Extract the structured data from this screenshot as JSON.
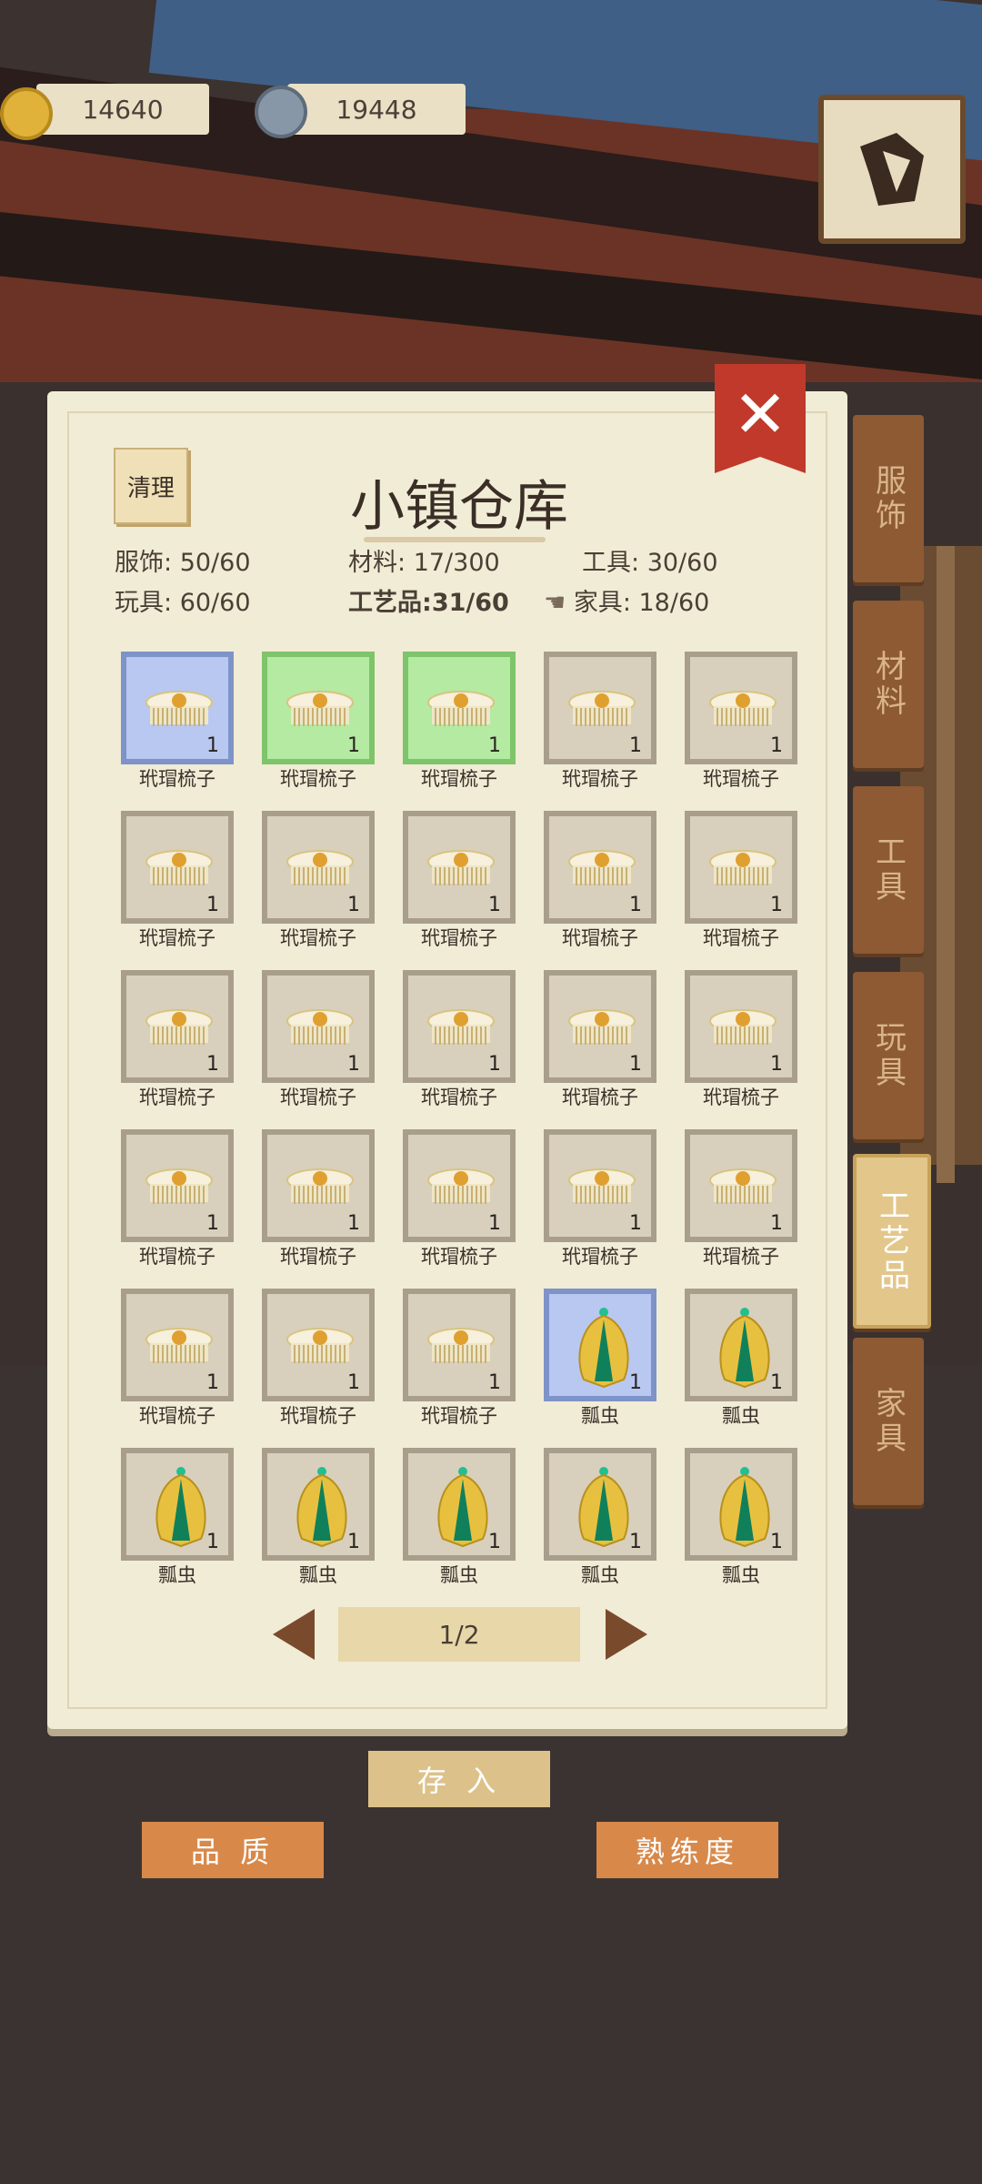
{
  "currency": {
    "coins": "14640",
    "gears": "19448"
  },
  "panel": {
    "title": "小镇仓库",
    "clean_label": "清理",
    "close_label": "✕",
    "stats": [
      {
        "label": "服饰",
        "value": "50/60"
      },
      {
        "label": "材料",
        "value": "17/300"
      },
      {
        "label": "工具",
        "value": "30/60"
      },
      {
        "label": "玩具",
        "value": "60/60"
      },
      {
        "label": "工艺品",
        "value": "31/60"
      },
      {
        "label": "家具",
        "value": "18/60"
      }
    ],
    "items": [
      {
        "name": "玳瑁梳子",
        "qty": "1",
        "rarity": "blue",
        "icon": "comb-icon"
      },
      {
        "name": "玳瑁梳子",
        "qty": "1",
        "rarity": "green",
        "icon": "comb-icon"
      },
      {
        "name": "玳瑁梳子",
        "qty": "1",
        "rarity": "green",
        "icon": "comb-icon"
      },
      {
        "name": "玳瑁梳子",
        "qty": "1",
        "rarity": "normal",
        "icon": "comb-icon"
      },
      {
        "name": "玳瑁梳子",
        "qty": "1",
        "rarity": "normal",
        "icon": "comb-icon"
      },
      {
        "name": "玳瑁梳子",
        "qty": "1",
        "rarity": "normal",
        "icon": "comb-icon"
      },
      {
        "name": "玳瑁梳子",
        "qty": "1",
        "rarity": "normal",
        "icon": "comb-icon"
      },
      {
        "name": "玳瑁梳子",
        "qty": "1",
        "rarity": "normal",
        "icon": "comb-icon"
      },
      {
        "name": "玳瑁梳子",
        "qty": "1",
        "rarity": "normal",
        "icon": "comb-icon"
      },
      {
        "name": "玳瑁梳子",
        "qty": "1",
        "rarity": "normal",
        "icon": "comb-icon"
      },
      {
        "name": "玳瑁梳子",
        "qty": "1",
        "rarity": "normal",
        "icon": "comb-icon"
      },
      {
        "name": "玳瑁梳子",
        "qty": "1",
        "rarity": "normal",
        "icon": "comb-icon"
      },
      {
        "name": "玳瑁梳子",
        "qty": "1",
        "rarity": "normal",
        "icon": "comb-icon"
      },
      {
        "name": "玳瑁梳子",
        "qty": "1",
        "rarity": "normal",
        "icon": "comb-icon"
      },
      {
        "name": "玳瑁梳子",
        "qty": "1",
        "rarity": "normal",
        "icon": "comb-icon"
      },
      {
        "name": "玳瑁梳子",
        "qty": "1",
        "rarity": "normal",
        "icon": "comb-icon"
      },
      {
        "name": "玳瑁梳子",
        "qty": "1",
        "rarity": "normal",
        "icon": "comb-icon"
      },
      {
        "name": "玳瑁梳子",
        "qty": "1",
        "rarity": "normal",
        "icon": "comb-icon"
      },
      {
        "name": "玳瑁梳子",
        "qty": "1",
        "rarity": "normal",
        "icon": "comb-icon"
      },
      {
        "name": "玳瑁梳子",
        "qty": "1",
        "rarity": "normal",
        "icon": "comb-icon"
      },
      {
        "name": "玳瑁梳子",
        "qty": "1",
        "rarity": "normal",
        "icon": "comb-icon"
      },
      {
        "name": "玳瑁梳子",
        "qty": "1",
        "rarity": "normal",
        "icon": "comb-icon"
      },
      {
        "name": "玳瑁梳子",
        "qty": "1",
        "rarity": "normal",
        "icon": "comb-icon"
      },
      {
        "name": "瓢虫",
        "qty": "1",
        "rarity": "blue",
        "icon": "ladybug-icon"
      },
      {
        "name": "瓢虫",
        "qty": "1",
        "rarity": "normal",
        "icon": "ladybug-icon"
      },
      {
        "name": "瓢虫",
        "qty": "1",
        "rarity": "normal",
        "icon": "ladybug-icon"
      },
      {
        "name": "瓢虫",
        "qty": "1",
        "rarity": "normal",
        "icon": "ladybug-icon"
      },
      {
        "name": "瓢虫",
        "qty": "1",
        "rarity": "normal",
        "icon": "ladybug-icon"
      },
      {
        "name": "瓢虫",
        "qty": "1",
        "rarity": "normal",
        "icon": "ladybug-icon"
      },
      {
        "name": "瓢虫",
        "qty": "1",
        "rarity": "normal",
        "icon": "ladybug-icon"
      }
    ],
    "pager": {
      "page": "1/2"
    }
  },
  "tabs": [
    {
      "label": "服饰",
      "active": false
    },
    {
      "label": "材料",
      "active": false
    },
    {
      "label": "工具",
      "active": false
    },
    {
      "label": "玩具",
      "active": false
    },
    {
      "label": "工艺品",
      "active": true
    },
    {
      "label": "家具",
      "active": false
    }
  ],
  "buttons": {
    "deposit": "存 入",
    "quality": "品 质",
    "proficiency": "熟练度"
  },
  "colors": {
    "rarity_blue": "#b8c8f0",
    "rarity_green": "#b4eaa2",
    "tab_brown": "#8d5a34",
    "button_orange": "#d8894a"
  }
}
